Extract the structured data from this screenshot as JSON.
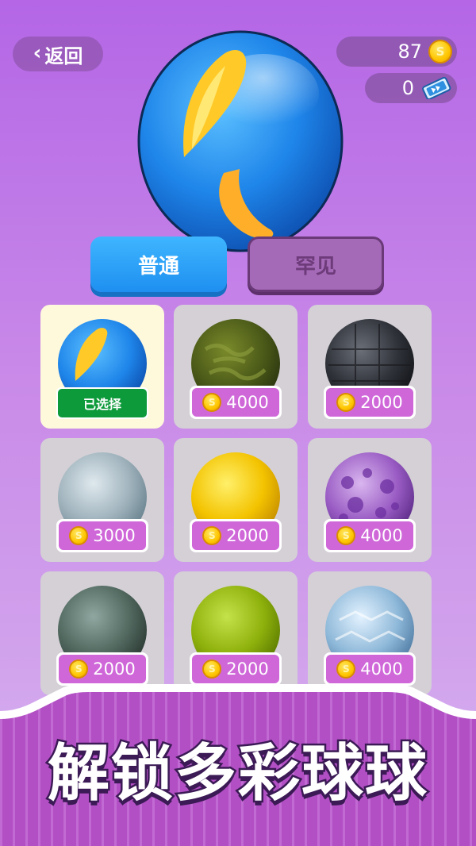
{
  "header": {
    "back_label": "返回",
    "coins": "87",
    "tickets": "0"
  },
  "tabs": [
    {
      "label": "普通",
      "active": true
    },
    {
      "label": "罕见",
      "active": false
    }
  ],
  "balls": [
    {
      "status": "已选择",
      "selected": true,
      "style": "blue-flame"
    },
    {
      "price": "4000",
      "style": "camo-green"
    },
    {
      "price": "2000",
      "style": "dark-stone"
    },
    {
      "price": "3000",
      "style": "ice-gray"
    },
    {
      "price": "2000",
      "style": "yellow"
    },
    {
      "price": "4000",
      "style": "purple-spots"
    },
    {
      "price": "2000",
      "style": "slate-green"
    },
    {
      "price": "2000",
      "style": "lime"
    },
    {
      "price": "4000",
      "style": "ice-blue"
    }
  ],
  "banner": {
    "text": "解锁多彩球球"
  },
  "colors": {
    "active_tab": "#2a9ff5",
    "inactive_tab": "#a56ab7",
    "price_bg": "#cf67d9",
    "selected_badge": "#0d9a3a"
  }
}
